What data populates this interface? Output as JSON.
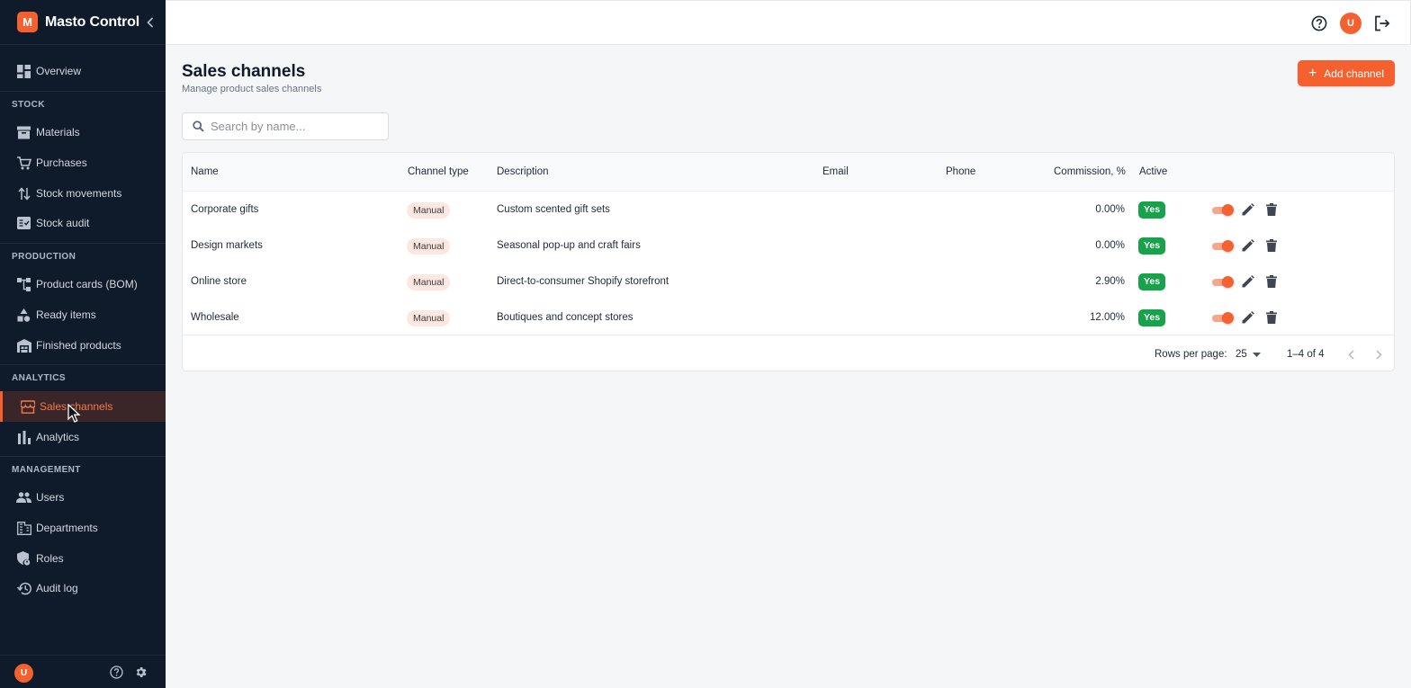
{
  "app": {
    "logo_letter": "M",
    "title": "Masto Control"
  },
  "sidebar": {
    "overview": "Overview",
    "sections": {
      "stock": "STOCK",
      "production": "PRODUCTION",
      "analytics": "ANALYTICS",
      "management": "MANAGEMENT"
    },
    "items": {
      "materials": "Materials",
      "purchases": "Purchases",
      "stock_movements": "Stock movements",
      "stock_audit": "Stock audit",
      "product_cards": "Product cards (BOM)",
      "ready_items": "Ready items",
      "finished_products": "Finished products",
      "sales_channels": "Sales channels",
      "analytics": "Analytics",
      "users": "Users",
      "departments": "Departments",
      "roles": "Roles",
      "audit_log": "Audit log"
    },
    "footer_avatar": "U"
  },
  "header": {
    "avatar": "U"
  },
  "page": {
    "title": "Sales channels",
    "subtitle": "Manage product sales channels",
    "add_button": "Add channel",
    "search_placeholder": "Search by name..."
  },
  "table": {
    "columns": {
      "name": "Name",
      "channel_type": "Channel type",
      "description": "Description",
      "email": "Email",
      "phone": "Phone",
      "commission": "Commission, %",
      "active": "Active"
    },
    "rows": [
      {
        "name": "Corporate gifts",
        "type": "Manual",
        "description": "Custom scented gift sets",
        "email": "",
        "phone": "",
        "commission": "0.00%",
        "active": "Yes"
      },
      {
        "name": "Design markets",
        "type": "Manual",
        "description": "Seasonal pop-up and craft fairs",
        "email": "",
        "phone": "",
        "commission": "0.00%",
        "active": "Yes"
      },
      {
        "name": "Online store",
        "type": "Manual",
        "description": "Direct-to-consumer Shopify storefront",
        "email": "",
        "phone": "",
        "commission": "2.90%",
        "active": "Yes"
      },
      {
        "name": "Wholesale",
        "type": "Manual",
        "description": "Boutiques and concept stores",
        "email": "",
        "phone": "",
        "commission": "12.00%",
        "active": "Yes"
      }
    ],
    "footer": {
      "rows_per_page_label": "Rows per page:",
      "rows_per_page_value": "25",
      "range": "1–4 of 4"
    }
  },
  "colors": {
    "accent": "#f4612f",
    "sidebar_bg": "#0f1a2a",
    "active_badge": "#16a34a",
    "chip_bg": "#fde7e1"
  }
}
